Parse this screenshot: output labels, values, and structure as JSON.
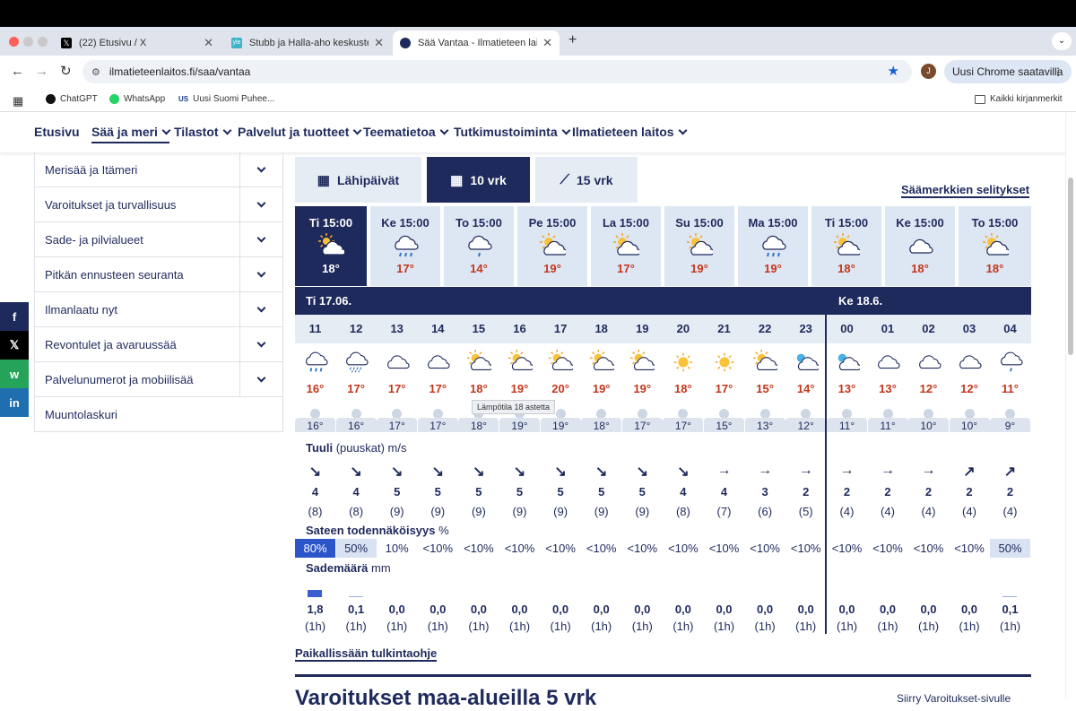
{
  "browser": {
    "tabs": [
      {
        "title": "(22) Etusivu / X",
        "icon": "x-logo-icon"
      },
      {
        "title": "Stubb ja Halla-aho keskustele",
        "icon": "yle-logo-icon"
      },
      {
        "title": "Sää Vantaa - Ilmatieteen laitos",
        "icon": "fmi-logo-icon"
      }
    ],
    "new_tab": "+",
    "url": "ilmatieteenlaitos.fi/saa/vantaa",
    "profile_letter": "J",
    "chrome_update": "Uusi Chrome saatavilla",
    "bookmarks": [
      "ChatGPT",
      "WhatsApp",
      "Uusi Suomi Puhee..."
    ],
    "all_bookmarks": "Kaikki kirjanmerkit"
  },
  "nav": {
    "items": [
      "Etusivu",
      "Sää ja meri",
      "Tilastot",
      "Palvelut ja tuotteet",
      "Teematietoa",
      "Tutkimustoiminta",
      "Ilmatieteen laitos"
    ]
  },
  "sidebar": {
    "items": [
      "Merisää ja Itämeri",
      "Varoitukset ja turvallisuus",
      "Sade- ja pilvialueet",
      "Pitkän ennusteen seuranta",
      "Ilmanlaatu nyt",
      "Revontulet ja avaruussää",
      "Palvelunumerot ja mobiilisää",
      "Muuntolaskuri"
    ]
  },
  "social": [
    "f",
    "𝕏",
    "w",
    "in"
  ],
  "views": {
    "tabs": [
      "Lähipäivät",
      "10 vrk",
      "15 vrk"
    ],
    "legend_link": "Säämerkkien selitykset"
  },
  "days": [
    {
      "label": "Ti 15:00",
      "temp": "18°",
      "icon": "partly-cloudy"
    },
    {
      "label": "Ke 15:00",
      "temp": "17°",
      "icon": "cloud-rain"
    },
    {
      "label": "To 15:00",
      "temp": "14°",
      "icon": "cloud-rain-light"
    },
    {
      "label": "Pe 15:00",
      "temp": "19°",
      "icon": "sun-cloud"
    },
    {
      "label": "La 15:00",
      "temp": "17°",
      "icon": "sun-cloud"
    },
    {
      "label": "Su 15:00",
      "temp": "19°",
      "icon": "sun-cloud"
    },
    {
      "label": "Ma 15:00",
      "temp": "19°",
      "icon": "cloud-rain"
    },
    {
      "label": "Ti 15:00",
      "temp": "18°",
      "icon": "sun-cloud"
    },
    {
      "label": "Ke 15:00",
      "temp": "18°",
      "icon": "cloud"
    },
    {
      "label": "To 15:00",
      "temp": "18°",
      "icon": "sun-cloud"
    }
  ],
  "date_headers": [
    "Ti  17.06.",
    "Ke  18.6."
  ],
  "hours": [
    "11",
    "12",
    "13",
    "14",
    "15",
    "16",
    "17",
    "18",
    "19",
    "20",
    "21",
    "22",
    "23",
    "00",
    "01",
    "02",
    "03",
    "04"
  ],
  "hour_icons": [
    "cloud-rain",
    "cloud-drizzle",
    "cloud",
    "cloud",
    "sun-cloud",
    "sun-cloud",
    "sun-cloud",
    "sun-cloud",
    "sun-cloud",
    "sun",
    "sun",
    "sun-cloud",
    "moon-cloud",
    "moon-cloud",
    "cloud",
    "cloud",
    "cloud",
    "cloud-rain-light"
  ],
  "temps": [
    "16°",
    "17°",
    "17°",
    "17°",
    "18°",
    "19°",
    "20°",
    "19°",
    "19°",
    "18°",
    "17°",
    "15°",
    "14°",
    "13°",
    "13°",
    "12°",
    "12°",
    "11°"
  ],
  "feels": [
    "16°",
    "16°",
    "17°",
    "17°",
    "18°",
    "19°",
    "19°",
    "18°",
    "17°",
    "17°",
    "15°",
    "13°",
    "12°",
    "11°",
    "11°",
    "10°",
    "10°",
    "9°"
  ],
  "tooltip": "Lämpötila 18 astetta",
  "wind": {
    "title": "Tuuli",
    "subtitle": "(puuskat) m/s",
    "directions": [
      "↘",
      "↘",
      "↘",
      "↘",
      "↘",
      "↘",
      "↘",
      "↘",
      "↘",
      "↘",
      "→",
      "→",
      "→",
      "→",
      "→",
      "→",
      "↗",
      "↗"
    ],
    "speeds": [
      "4",
      "4",
      "5",
      "5",
      "5",
      "5",
      "5",
      "5",
      "5",
      "4",
      "4",
      "3",
      "2",
      "2",
      "2",
      "2",
      "2",
      "2"
    ],
    "gusts": [
      "(8)",
      "(8)",
      "(9)",
      "(9)",
      "(9)",
      "(9)",
      "(9)",
      "(9)",
      "(9)",
      "(8)",
      "(7)",
      "(6)",
      "(5)",
      "(4)",
      "(4)",
      "(4)",
      "(4)",
      "(4)"
    ]
  },
  "precip_prob": {
    "title": "Sateen todennäköisyys",
    "unit": "%",
    "values": [
      "80%",
      "50%",
      "10%",
      "<10%",
      "<10%",
      "<10%",
      "<10%",
      "<10%",
      "<10%",
      "<10%",
      "<10%",
      "<10%",
      "<10%",
      "<10%",
      "<10%",
      "<10%",
      "<10%",
      "50%"
    ],
    "levels": [
      0.8,
      0.5,
      0.1,
      0.05,
      0.05,
      0.05,
      0.05,
      0.05,
      0.05,
      0.05,
      0.05,
      0.05,
      0.05,
      0.05,
      0.05,
      0.05,
      0.05,
      0.5
    ]
  },
  "precip_amount": {
    "title": "Sademäärä",
    "unit": "mm",
    "values": [
      "1,8",
      "0,1",
      "0,0",
      "0,0",
      "0,0",
      "0,0",
      "0,0",
      "0,0",
      "0,0",
      "0,0",
      "0,0",
      "0,0",
      "0,0",
      "0,0",
      "0,0",
      "0,0",
      "0,0",
      "0,1"
    ],
    "mm": [
      1.8,
      0.1,
      0,
      0,
      0,
      0,
      0,
      0,
      0,
      0,
      0,
      0,
      0,
      0,
      0,
      0,
      0,
      0.1
    ],
    "durations": [
      "(1h)",
      "(1h)",
      "(1h)",
      "(1h)",
      "(1h)",
      "(1h)",
      "(1h)",
      "(1h)",
      "(1h)",
      "(1h)",
      "(1h)",
      "(1h)",
      "(1h)",
      "(1h)",
      "(1h)",
      "(1h)",
      "(1h)",
      "(1h)"
    ]
  },
  "guide_link": "Paikallissään tulkintaohje",
  "bottom": {
    "title": "Varoitukset maa-alueilla 5 vrk",
    "right": "Siirry Varoitukset-sivulle"
  },
  "colors": {
    "brand": "#1f2a5c",
    "temp": "#c4361b",
    "card": "#dde6f3",
    "precip": "#3b5fd0"
  }
}
